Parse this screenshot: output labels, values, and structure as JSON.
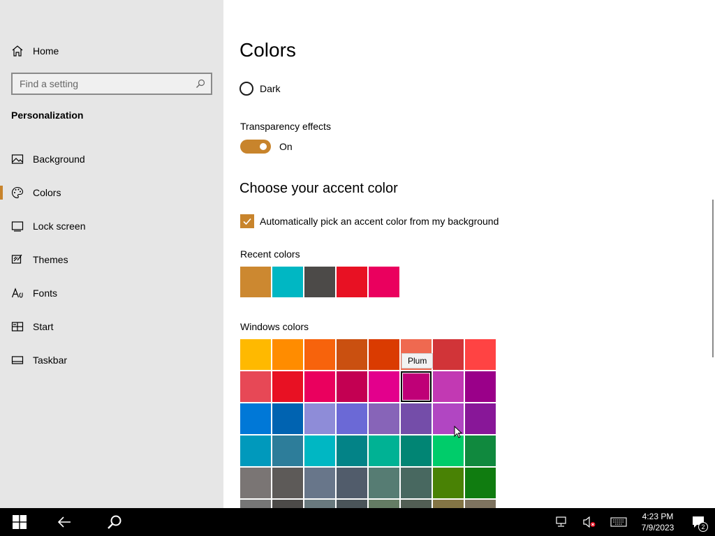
{
  "sidebar": {
    "home_label": "Home",
    "search_placeholder": "Find a setting",
    "section_title": "Personalization",
    "items": [
      {
        "label": "Background",
        "icon": "image-icon"
      },
      {
        "label": "Colors",
        "icon": "palette-icon",
        "selected": true
      },
      {
        "label": "Lock screen",
        "icon": "lock-screen-icon"
      },
      {
        "label": "Themes",
        "icon": "themes-icon"
      },
      {
        "label": "Fonts",
        "icon": "fonts-icon"
      },
      {
        "label": "Start",
        "icon": "start-icon"
      },
      {
        "label": "Taskbar",
        "icon": "taskbar-icon"
      }
    ]
  },
  "main": {
    "title": "Colors",
    "mode_option": "Dark",
    "transparency_label": "Transparency effects",
    "transparency_state": "On",
    "accent_heading": "Choose your accent color",
    "auto_pick_label": "Automatically pick an accent color from my background",
    "auto_pick_checked": true,
    "recent_label": "Recent colors",
    "recent_colors": [
      "#cc8830",
      "#00b7c3",
      "#4c4a48",
      "#e81123",
      "#ea005e"
    ],
    "windows_label": "Windows colors",
    "windows_colors": [
      [
        "#ffb900",
        "#ff8c00",
        "#f7630c",
        "#ca5010",
        "#da3b01",
        "#ef6950",
        "#d13438",
        "#ff4343"
      ],
      [
        "#e74856",
        "#e81123",
        "#ea005e",
        "#c30052",
        "#e3008c",
        "#bf0077",
        "#c239b3",
        "#9a0089"
      ],
      [
        "#0078d7",
        "#0063b1",
        "#8e8cd8",
        "#6b69d6",
        "#8764b8",
        "#744da9",
        "#b146c2",
        "#881798"
      ],
      [
        "#0099bc",
        "#2d7d9a",
        "#00b7c3",
        "#038387",
        "#00b294",
        "#018574",
        "#00cc6a",
        "#10893e"
      ],
      [
        "#7a7574",
        "#5d5a58",
        "#68768a",
        "#515c6b",
        "#567c73",
        "#486860",
        "#498205",
        "#107c10"
      ],
      [
        "#767676",
        "#4c4a48",
        "#69797e",
        "#4a5459",
        "#647c64",
        "#525e54",
        "#847545",
        "#7e735f"
      ]
    ],
    "selected_swatch_name": "Plum",
    "accent_color": "#c8842c"
  },
  "taskbar": {
    "time": "4:23 PM",
    "date": "7/9/2023",
    "notification_count": "2"
  }
}
